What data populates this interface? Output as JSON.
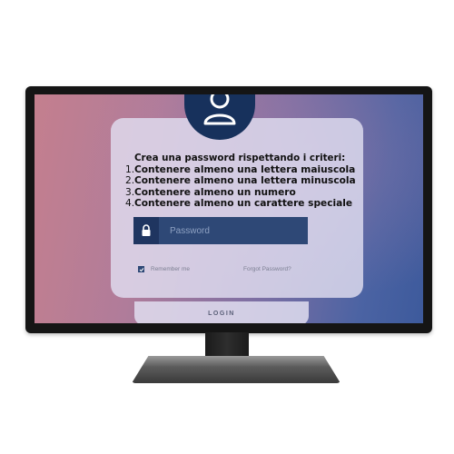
{
  "instructions": {
    "heading": "Crea una password rispettando i criteri:",
    "criteria": [
      {
        "number": "1.",
        "text": "Contenere almeno una lettera maiuscola"
      },
      {
        "number": "2.",
        "text": "Contenere almeno una lettera minuscola"
      },
      {
        "number": "3.",
        "text": "Contenere almeno un numero"
      },
      {
        "number": "4.",
        "text": "Contenere almeno un carattere speciale"
      }
    ]
  },
  "login_form": {
    "password_placeholder": "Password",
    "remember_label": "Remember me",
    "remember_checked": true,
    "forgot_label": "Forgot Password?",
    "login_label": "LOGIN"
  },
  "icons": {
    "avatar": "user-icon",
    "lock": "lock-icon",
    "check": "check-icon"
  },
  "colors": {
    "accent_navy": "#17315c",
    "field_blue": "#2e4876"
  }
}
